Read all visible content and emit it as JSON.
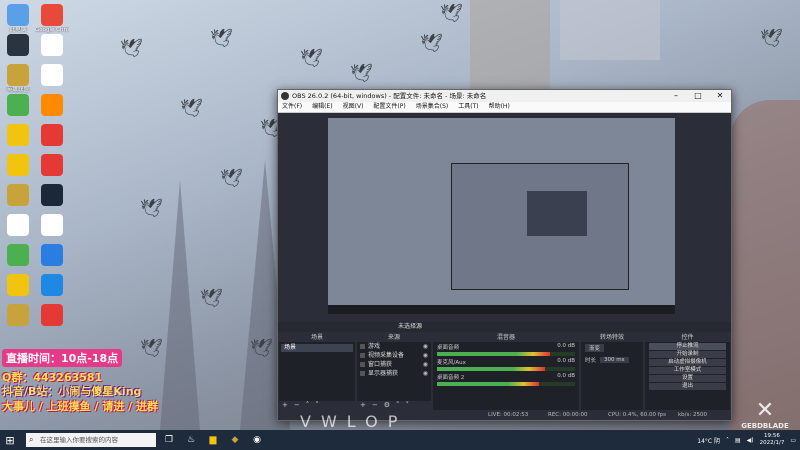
{
  "desktop": {
    "icons": [
      {
        "label": "此电脑",
        "color": "#5aa0e8",
        "icon": "computer-icon"
      },
      {
        "label": "Google Chrome",
        "color": "#e84a3a",
        "icon": "chrome-icon"
      },
      {
        "label": "",
        "color": "#2a3340",
        "icon": "obs-icon"
      },
      {
        "label": "",
        "color": "#ffffff",
        "icon": "document-icon"
      },
      {
        "label": "英雄联盟",
        "color": "#c8a23a",
        "icon": "league-icon"
      },
      {
        "label": "",
        "color": "#ffffff",
        "icon": "document-icon"
      },
      {
        "label": "",
        "color": "#4caf50",
        "icon": "ball-icon"
      },
      {
        "label": "",
        "color": "#ff8a00",
        "icon": "app-icon"
      },
      {
        "label": "",
        "color": "#f1c40f",
        "icon": "game-icon"
      },
      {
        "label": "",
        "color": "#e53935",
        "icon": "app-icon"
      },
      {
        "label": "",
        "color": "#f1c40f",
        "icon": "folder-icon"
      },
      {
        "label": "",
        "color": "#e53935",
        "icon": "app-icon"
      },
      {
        "label": "",
        "color": "#c8a23a",
        "icon": "league-icon"
      },
      {
        "label": "",
        "color": "#1b2838",
        "icon": "steam-icon"
      },
      {
        "label": "",
        "color": "#ffffff",
        "icon": "qq-icon"
      },
      {
        "label": "",
        "color": "#ffffff",
        "icon": "document-icon"
      },
      {
        "label": "",
        "color": "#4caf50",
        "icon": "wechat-icon"
      },
      {
        "label": "",
        "color": "#2a7de1",
        "icon": "shield-icon"
      },
      {
        "label": "",
        "color": "#f1c40f",
        "icon": "app-icon"
      },
      {
        "label": "",
        "color": "#1e88e5",
        "icon": "edge-icon"
      },
      {
        "label": "",
        "color": "#c8a23a",
        "icon": "league-icon"
      },
      {
        "label": "",
        "color": "#e53935",
        "icon": "app-icon"
      }
    ]
  },
  "overlay": {
    "time": "直播时间：10点-18点",
    "qq": "Q群：443263581",
    "douyin": "抖音/B站：小闹与傻星King",
    "extra": "大事儿 / 上班摸鱼 / 请进 / 进群"
  },
  "obs": {
    "title": "OBS 26.0.2 (64-bit, windows) - 配置文件: 未命名 - 场景: 未命名",
    "menu": [
      "文件(F)",
      "编辑(E)",
      "视图(V)",
      "配置文件(P)",
      "场景集合(S)",
      "工具(T)",
      "帮助(H)"
    ],
    "status_mid": "未选择源",
    "docks": {
      "scenes": {
        "title": "场景",
        "item": "场景"
      },
      "sources": {
        "title": "来源",
        "items": [
          "游戏",
          "视频采集设备",
          "窗口捕获",
          "显示器捕获"
        ]
      },
      "mixer": {
        "title": "混音器",
        "rows": [
          {
            "name": "桌面音频",
            "db": "0.0 dB",
            "level": 0.82
          },
          {
            "name": "麦克风/Aux",
            "db": "0.0 dB",
            "level": 0.78
          },
          {
            "name": "桌面音频 2",
            "db": "0.0 dB",
            "level": 0.74
          }
        ]
      },
      "transitions": {
        "title": "转场特效",
        "type": "渐变",
        "duration_label": "时长",
        "duration": "300 ms"
      },
      "controls": {
        "title": "控件",
        "buttons": [
          "停止推流",
          "开始录制",
          "启动虚拟摄像机",
          "工作室模式",
          "设置",
          "退出"
        ]
      }
    },
    "statusbar": {
      "live": "LIVE: 00:02:53",
      "rec": "REC: 00:00:00",
      "cpu": "CPU: 0.4%, 60.00 fps",
      "kbps": "kb/s: 2500"
    }
  },
  "taskbar": {
    "search_placeholder": "在这里输入你要搜索的内容",
    "weather": "14°C 阴",
    "time": "19:56",
    "date": "2022/1/7"
  },
  "watermark": {
    "brand": "GEBDBLADE",
    "bottom": "VWLOP"
  }
}
